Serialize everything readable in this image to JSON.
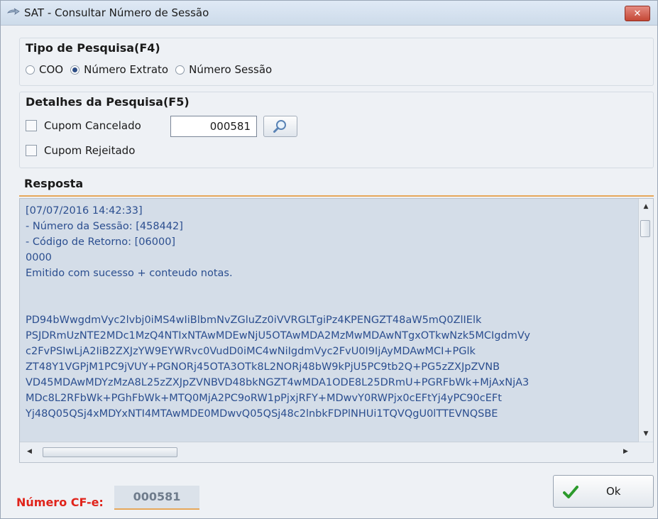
{
  "window": {
    "title": "SAT - Consultar Número de Sessão",
    "close_label": "✕"
  },
  "tipo_pesquisa": {
    "title": "Tipo de Pesquisa(F4)",
    "options": [
      {
        "label": "COO",
        "checked": false
      },
      {
        "label": "Número Extrato",
        "checked": true
      },
      {
        "label": "Número Sessão",
        "checked": false
      }
    ]
  },
  "detalhes": {
    "title": "Detalhes da Pesquisa(F5)",
    "cupom_cancelado": "Cupom Cancelado",
    "cupom_rejeitado": "Cupom Rejeitado",
    "numero_value": "000581"
  },
  "resposta": {
    "title": "Resposta",
    "lines": [
      "[07/07/2016 14:42:33]",
      "- Número da Sessão: [458442]",
      "- Código de Retorno: [06000]",
      "0000",
      "Emitido com sucesso + conteudo notas.",
      "",
      "",
      "PD94bWwgdmVyc2lvbj0iMS4wIiBlbmNvZGluZz0iVVRGLTgiPz4KPENGZT48aW5mQ0ZlIElk",
      "PSJDRmUzNTE2MDc1MzQ4NTIxNTAwMDEwNjU5OTAwMDA2MzMwMDAwNTgxOTkwNzk5MCIgdmVy",
      "c2FvPSIwLjA2IiB2ZXJzYW9EYWRvc0VudD0iMC4wNiIgdmVyc2FvU0I9IjAyMDAwMCI+PGlk",
      "ZT48Y1VGPjM1PC9jVUY+PGNORj45OTA3OTk8L2NORj48bW9kPjU5PC9tb2Q+PG5zZXJpZVNB",
      "VD45MDAwMDYzMzA8L25zZXJpZVNBVD48bkNGZT4wMDA1ODE8L25DRmU+PGRFbWk+MjAxNjA3",
      "MDc8L2RFbWk+PGhFbWk+MTQ0MjA2PC9oRW1pPjxjRFY+MDwvY0RWPjx0cEFtYj4yPC90cEFt",
      "Yj48Q05QSj4xMDYxNTI4MTAwMDE0MDwvQ05QSj48c2lnbkFDPlNHUi1TQVQgU0lTTEVNQSBE"
    ]
  },
  "footer": {
    "cfe_label": "Número CF-e:",
    "cfe_value": "000581",
    "ok_label": "Ok"
  }
}
